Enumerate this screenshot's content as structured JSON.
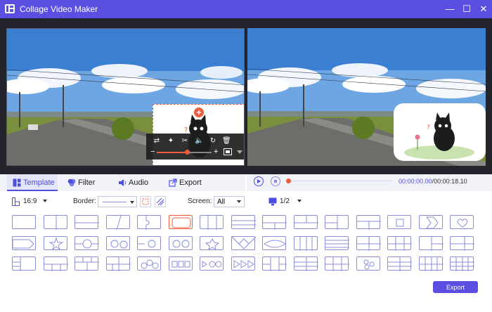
{
  "app": {
    "title": "Collage Video Maker"
  },
  "window_controls": {
    "minimize": "—",
    "maximize": "☐",
    "close": "✕"
  },
  "tabs": [
    {
      "label": "Template",
      "icon": "template-icon",
      "active": true
    },
    {
      "label": "Filter",
      "icon": "filter-icon",
      "active": false
    },
    {
      "label": "Audio",
      "icon": "audio-icon",
      "active": false
    },
    {
      "label": "Export",
      "icon": "export-icon",
      "active": false
    }
  ],
  "playback": {
    "current_time": "00:00:00.00",
    "separator": "/",
    "total_time": "00:00:18.10",
    "progress": 0
  },
  "options": {
    "aspect_ratio": "16:9",
    "border_label": "Border:",
    "screen_label": "Screen:",
    "screen_value": "All",
    "page_value": "1/2"
  },
  "export_button": "Export",
  "edit_toolbar": {
    "zoom_level": 0.55
  },
  "colors": {
    "accent": "#5b4fe1",
    "highlight": "#ef5c3d",
    "template_outline": "#8a8ed9"
  },
  "templates": [
    "single",
    "split-2-vertical",
    "split-2-horizontal",
    "diagonal-2",
    "puzzle-2",
    "rounded-single-selected",
    "split-3-vertical",
    "split-3-horizontal",
    "grid-2x2-right",
    "split-2-with-top",
    "split-2-with-top-left",
    "split-tee",
    "square-center",
    "arrow-right",
    "heart",
    "ribbon",
    "star",
    "circle-center",
    "two-circles",
    "circle-gear",
    "two-circles-horizontal",
    "star-burst",
    "diamond-cross",
    "eye",
    "split-4-vertical",
    "split-4-horizontal",
    "grid-2x2",
    "grid-2x3",
    "grid-3-mixed",
    "grid-2-mixed",
    "left-strip-3",
    "bottom-3",
    "grid-3-top",
    "grid-4-mixed",
    "three-circles",
    "three-squares",
    "circles-play",
    "arrows-forward",
    "grid-6-mixed",
    "grid-6-vertical",
    "grid-6-horizontal",
    "dots-four",
    "grid-6-mixed-2",
    "grid-8",
    "grid-3x4"
  ]
}
